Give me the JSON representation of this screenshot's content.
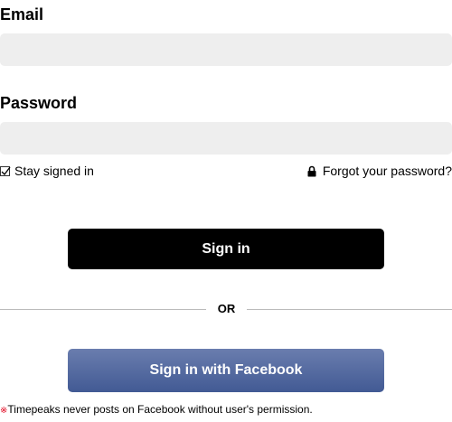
{
  "email": {
    "label": "Email",
    "value": "",
    "placeholder": ""
  },
  "password": {
    "label": "Password",
    "value": "",
    "placeholder": ""
  },
  "options": {
    "stay_signed_in_label": "Stay signed in",
    "stay_signed_in_checked": true,
    "forgot_password_label": "Forgot your password?"
  },
  "actions": {
    "sign_in_label": "Sign in",
    "divider_label": "OR",
    "facebook_label": "Sign in with Facebook"
  },
  "notice": {
    "mark": "※",
    "text": "Timepeaks never posts on Facebook without user's permission."
  },
  "colors": {
    "input_background": "#eeeeee",
    "primary_button": "#000000",
    "facebook_button_top": "#6a7dae",
    "facebook_button_bottom": "#425a94",
    "notice_mark": "#e0001b"
  },
  "icons": {
    "checkbox": "check-icon",
    "forgot": "lock-icon"
  }
}
